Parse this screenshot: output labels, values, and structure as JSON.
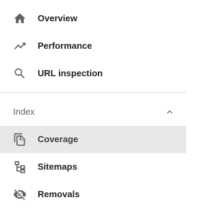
{
  "nav": {
    "top_items": [
      {
        "label": "Overview",
        "icon": "home-icon"
      },
      {
        "label": "Performance",
        "icon": "trending-up-icon"
      },
      {
        "label": "URL inspection",
        "icon": "search-icon"
      }
    ],
    "index_section": {
      "label": "Index",
      "expanded": true,
      "items": [
        {
          "label": "Coverage",
          "icon": "coverage-icon",
          "active": true
        },
        {
          "label": "Sitemaps",
          "icon": "sitemap-icon",
          "active": false
        },
        {
          "label": "Removals",
          "icon": "eye-off-icon",
          "active": false
        }
      ]
    }
  },
  "colors": {
    "icon": "#5f6368",
    "active_background": "#e8e8e8",
    "divider": "#dadce0"
  }
}
